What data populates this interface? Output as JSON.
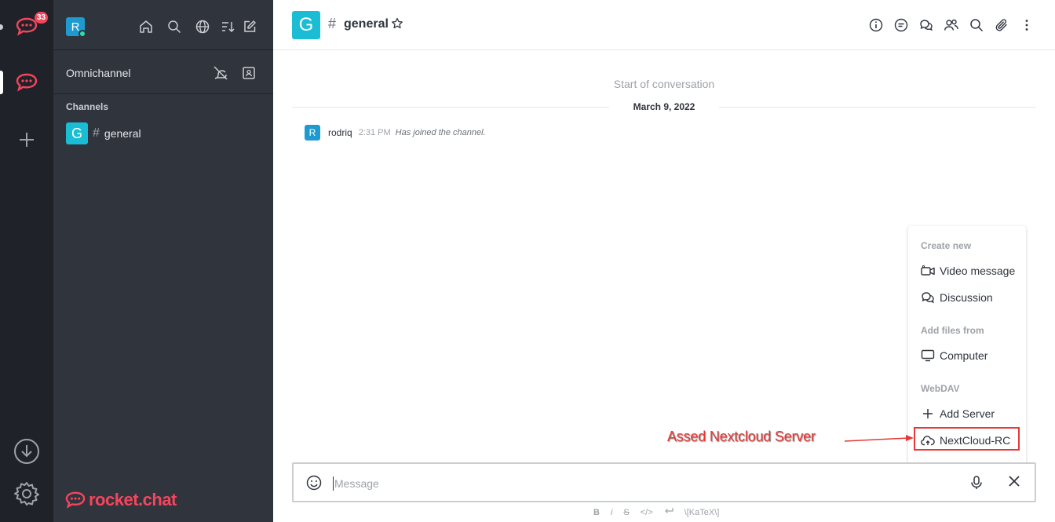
{
  "rail": {
    "badge": "33",
    "icons": [
      "rocket-chat-server-icon",
      "rocket-chat-active-server-icon",
      "add-server-icon",
      "download-icon",
      "settings-gear-icon"
    ]
  },
  "sidebar": {
    "user_initial": "R",
    "omnichannel_label": "Omnichannel",
    "channels_title": "Channels",
    "rooms": [
      {
        "initial": "G",
        "hash": "#",
        "name": "general"
      }
    ],
    "brand": "rocket.chat"
  },
  "header": {
    "room_initial": "G",
    "hash": "#",
    "room_name": "general"
  },
  "conversation": {
    "start_text": "Start of conversation",
    "date": "March 9, 2022",
    "messages": [
      {
        "initial": "R",
        "user": "rodriq",
        "time": "2:31 PM",
        "text": "Has joined the channel."
      }
    ]
  },
  "menu": {
    "section_create": "Create new",
    "video_message": "Video message",
    "discussion": "Discussion",
    "section_files": "Add files from",
    "computer": "Computer",
    "section_webdav": "WebDAV",
    "add_server": "Add Server",
    "nextcloud": "NextCloud-RC"
  },
  "annotation": {
    "label": "Assed Nextcloud Server",
    "color": "#e53935"
  },
  "composer": {
    "placeholder": "Message"
  },
  "format_bar": {
    "bold": "B",
    "italic": "i",
    "strike": "S",
    "code": "</>",
    "katex": "\\[KaTeX\\]"
  },
  "colors": {
    "rail_bg": "#1f2329",
    "sidebar_bg": "#2f343d",
    "brand_red": "#f5455c",
    "avatar_teal": "#1bbdd4",
    "avatar_blue": "#1d9bd1"
  }
}
